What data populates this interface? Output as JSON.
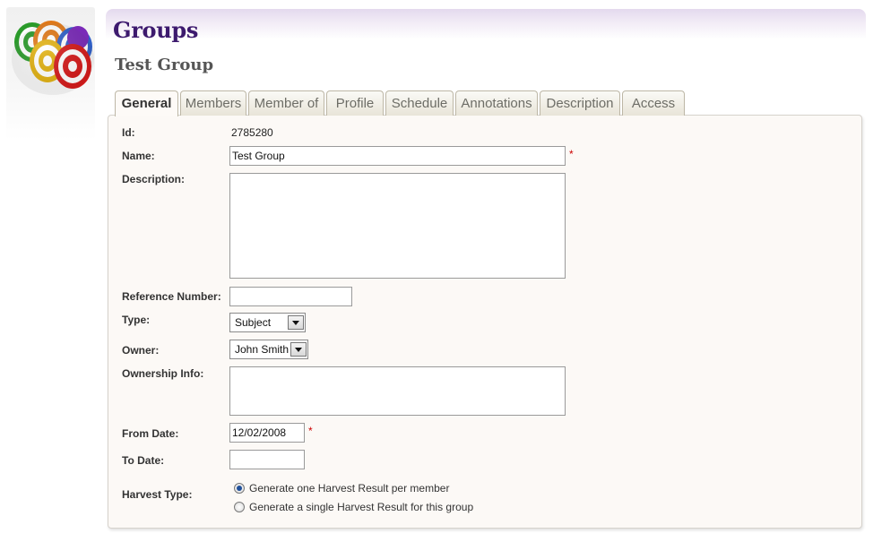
{
  "header": {
    "title": "Groups",
    "subtitle": "Test Group"
  },
  "tabs": [
    {
      "label": "General",
      "active": true
    },
    {
      "label": "Members",
      "active": false
    },
    {
      "label": "Member of",
      "active": false
    },
    {
      "label": "Profile",
      "active": false
    },
    {
      "label": "Schedule",
      "active": false
    },
    {
      "label": "Annotations",
      "active": false
    },
    {
      "label": "Description",
      "active": false
    },
    {
      "label": "Access",
      "active": false
    }
  ],
  "form": {
    "id_label": "Id:",
    "id_value": "2785280",
    "name_label": "Name:",
    "name_value": "Test Group",
    "description_label": "Description:",
    "description_value": "",
    "reference_label": "Reference Number:",
    "reference_value": "",
    "type_label": "Type:",
    "type_value": "Subject",
    "owner_label": "Owner:",
    "owner_value": "John Smith",
    "ownership_label": "Ownership Info:",
    "ownership_value": "",
    "from_date_label": "From Date:",
    "from_date_value": "12/02/2008",
    "to_date_label": "To Date:",
    "to_date_value": "",
    "harvest_label": "Harvest Type:",
    "harvest_options": [
      {
        "label": "Generate one Harvest Result per member",
        "checked": true
      },
      {
        "label": "Generate a single Harvest Result for this group",
        "checked": false
      }
    ],
    "required_marker": "*"
  },
  "colors": {
    "title": "#3d1a6e",
    "required": "#cc0000",
    "panel_bg": "#fcf9f6"
  },
  "icons": {
    "logo": "target-group-icon"
  }
}
